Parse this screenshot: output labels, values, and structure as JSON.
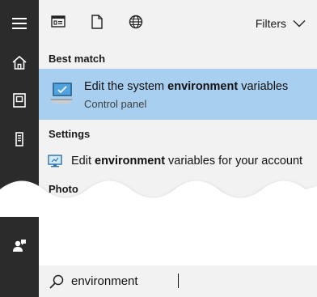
{
  "toolbar": {
    "icons": [
      "apps-icon",
      "document-icon",
      "web-globe-icon"
    ],
    "filters_label": "Filters"
  },
  "sidebar": {
    "icons": [
      "hamburger-menu-icon",
      "home-icon",
      "notebook-icon",
      "tower-pc-icon",
      "feedback-person-icon"
    ]
  },
  "results": {
    "best_match_header": "Best match",
    "best_match": {
      "title_prefix": "Edit the system ",
      "title_highlight": "environment",
      "title_suffix": " variables",
      "subtitle": "Control panel",
      "icon": "system-properties-icon"
    },
    "settings_header": "Settings",
    "settings_item": {
      "prefix": "Edit ",
      "highlight": "environment",
      "suffix": " variables for your account",
      "icon": "monitor-settings-icon"
    },
    "photos_header_partial": "Photo"
  },
  "search": {
    "value": "environment",
    "icon": "search-icon"
  },
  "colors": {
    "rail": "#2b2b2b",
    "panel": "#f2f2f2",
    "selected_row": "#a9cff0"
  }
}
